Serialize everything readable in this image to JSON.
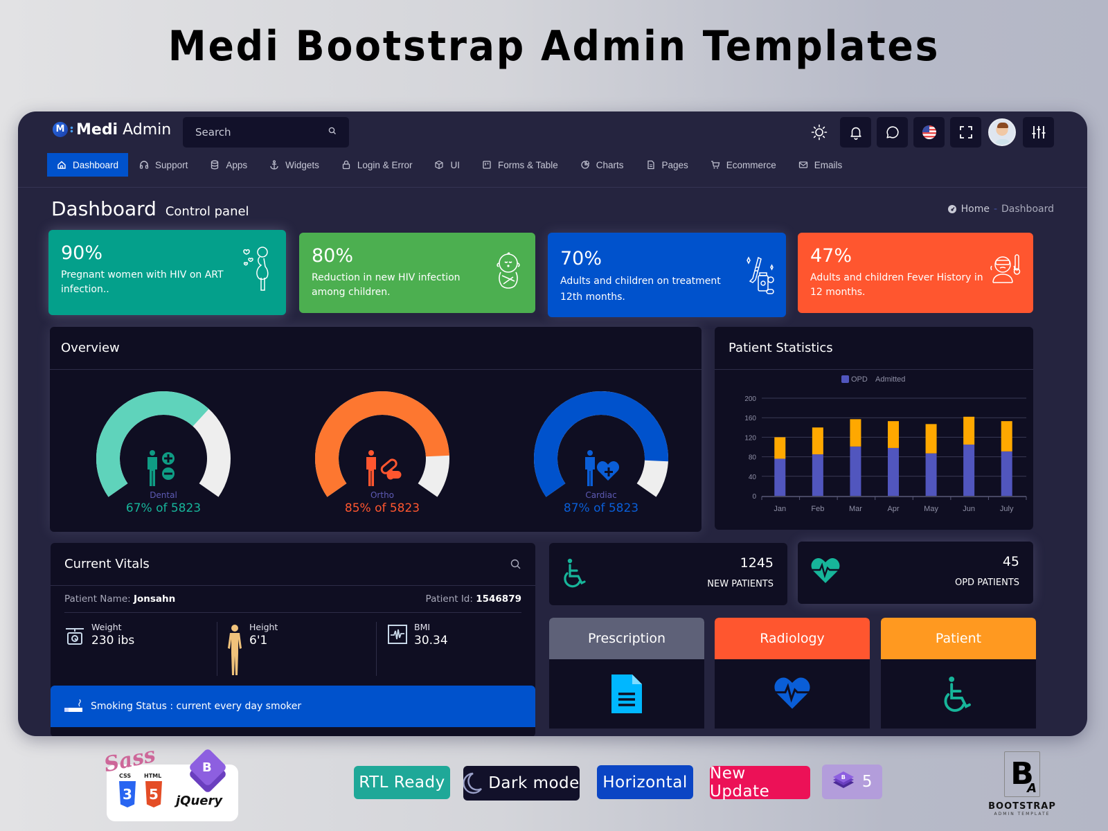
{
  "promo": {
    "title": "Medi Bootstrap Admin Templates",
    "badges": [
      {
        "label": "RTL Ready",
        "color": "#1fa898"
      },
      {
        "label": "Dark mode",
        "color": "#12112a"
      },
      {
        "label": "Horizontal",
        "color": "#0b45c4"
      },
      {
        "label": "New Update",
        "color": "#ec1157"
      },
      {
        "label": "5",
        "color": "#b39ddb"
      }
    ],
    "tech_logos": [
      "Sass",
      "CSS3",
      "HTML5",
      "Bootstrap",
      "jQuery"
    ],
    "css_label": "CSS",
    "html_label": "HTML",
    "jquery_label": "jQuery",
    "brand_letters": "B",
    "brand_sub_letter": "A",
    "brand_name": "BOOTSTRAP",
    "brand_tagline": "ADMIN TEMPLATE"
  },
  "app": {
    "logo_bold": "Medi",
    "logo_light": "Admin",
    "search_placeholder": "Search",
    "header_icons": [
      "sun-icon",
      "bell-icon",
      "chat-icon",
      "us-flag-icon",
      "fullscreen-icon",
      "avatar",
      "sliders-icon"
    ]
  },
  "nav": {
    "items": [
      {
        "label": "Dashboard",
        "icon": "home-icon",
        "active": true
      },
      {
        "label": "Support",
        "icon": "headphones-icon"
      },
      {
        "label": "Apps",
        "icon": "database-icon"
      },
      {
        "label": "Widgets",
        "icon": "anchor-icon"
      },
      {
        "label": "Login & Error",
        "icon": "lock-icon"
      },
      {
        "label": "UI",
        "icon": "cube-icon"
      },
      {
        "label": "Forms & Table",
        "icon": "form-icon"
      },
      {
        "label": "Charts",
        "icon": "pie-chart-icon"
      },
      {
        "label": "Pages",
        "icon": "file-icon"
      },
      {
        "label": "Ecommerce",
        "icon": "cart-icon"
      },
      {
        "label": "Emails",
        "icon": "mail-icon"
      }
    ]
  },
  "page": {
    "title": "Dashboard",
    "subtitle": "Control panel",
    "breadcrumb": [
      "Home",
      "Dashboard"
    ],
    "breadcrumb_sep": "-"
  },
  "stat_cards": [
    {
      "value": "90%",
      "text": "Pregnant women with HIV on ART infection..",
      "color": "#04a08b",
      "icon": "pregnant-woman-icon"
    },
    {
      "value": "80%",
      "text": "Reduction in new HIV infection among children.",
      "color": "#4caf50",
      "icon": "baby-icon"
    },
    {
      "value": "70%",
      "text": "Adults and children on treatment 12th months.",
      "color": "#0052cc",
      "icon": "medicine-icon"
    },
    {
      "value": "47%",
      "text": "Adults and children Fever History in 12 months.",
      "color": "#ff562f",
      "icon": "fever-icon"
    }
  ],
  "overview": {
    "title": "Overview",
    "gauges": [
      {
        "name": "Dental",
        "percent": 67,
        "total": 5823,
        "value_text": "67% of 5823",
        "color": "#5fd3bb",
        "text_color": "#17b59a",
        "icon_color": "#0f9c84"
      },
      {
        "name": "Ortho",
        "percent": 85,
        "total": 5823,
        "value_text": "85% of 5823",
        "color": "#fd7730",
        "text_color": "#ff562f",
        "icon_color": "#ff562f"
      },
      {
        "name": "Cardiac",
        "percent": 87,
        "total": 5823,
        "value_text": "87% of 5823",
        "color": "#0052cc",
        "text_color": "#0a5ed7",
        "icon_color": "#0a5ed7"
      }
    ],
    "track_color": "#eeeeee"
  },
  "patient_statistics": {
    "title": "Patient Statistics",
    "legend": [
      "OPD",
      "Admitted"
    ]
  },
  "chart_data": {
    "type": "bar",
    "stacked": true,
    "title": "Patient Statistics",
    "categories": [
      "Jan",
      "Feb",
      "Mar",
      "Apr",
      "May",
      "Jun",
      "July"
    ],
    "series": [
      {
        "name": "OPD",
        "color": "#5156be",
        "values": [
          76,
          85,
          101,
          98,
          87,
          105,
          91
        ]
      },
      {
        "name": "Admitted",
        "color": "#ffa800",
        "values": [
          44,
          55,
          56,
          55,
          60,
          57,
          62
        ]
      }
    ],
    "yticks": [
      0,
      40,
      80,
      120,
      160,
      200
    ],
    "ylim": [
      0,
      200
    ],
    "xlabel": "",
    "ylabel": "",
    "grid": true,
    "legend_position": "top-center"
  },
  "vitals": {
    "title": "Current Vitals",
    "patient_name_label": "Patient Name:",
    "patient_name": "Jonsahn",
    "patient_id_label": "Patient Id:",
    "patient_id": "1546879",
    "items": [
      {
        "label": "Weight",
        "value": "230 ibs",
        "icon": "scale-icon"
      },
      {
        "label": "Height",
        "value": "6'1",
        "icon": "body-icon"
      },
      {
        "label": "BMI",
        "value": "30.34",
        "icon": "bmi-icon"
      }
    ],
    "smoking": "Smoking Status : current every day smoker"
  },
  "mini_stats": [
    {
      "value": "1245",
      "label": "NEW PATIENTS",
      "icon": "wheelchair-icon"
    },
    {
      "value": "45",
      "label": "OPD PATIENTS",
      "icon": "heartbeat-icon"
    }
  ],
  "tiles": [
    {
      "label": "Prescription",
      "color": "#5e6178",
      "icon": "document-icon"
    },
    {
      "label": "Radiology",
      "color": "#ff562f",
      "icon": "heartbeat-icon"
    },
    {
      "label": "Patient",
      "color": "#ff9920",
      "icon": "wheelchair-icon"
    }
  ]
}
